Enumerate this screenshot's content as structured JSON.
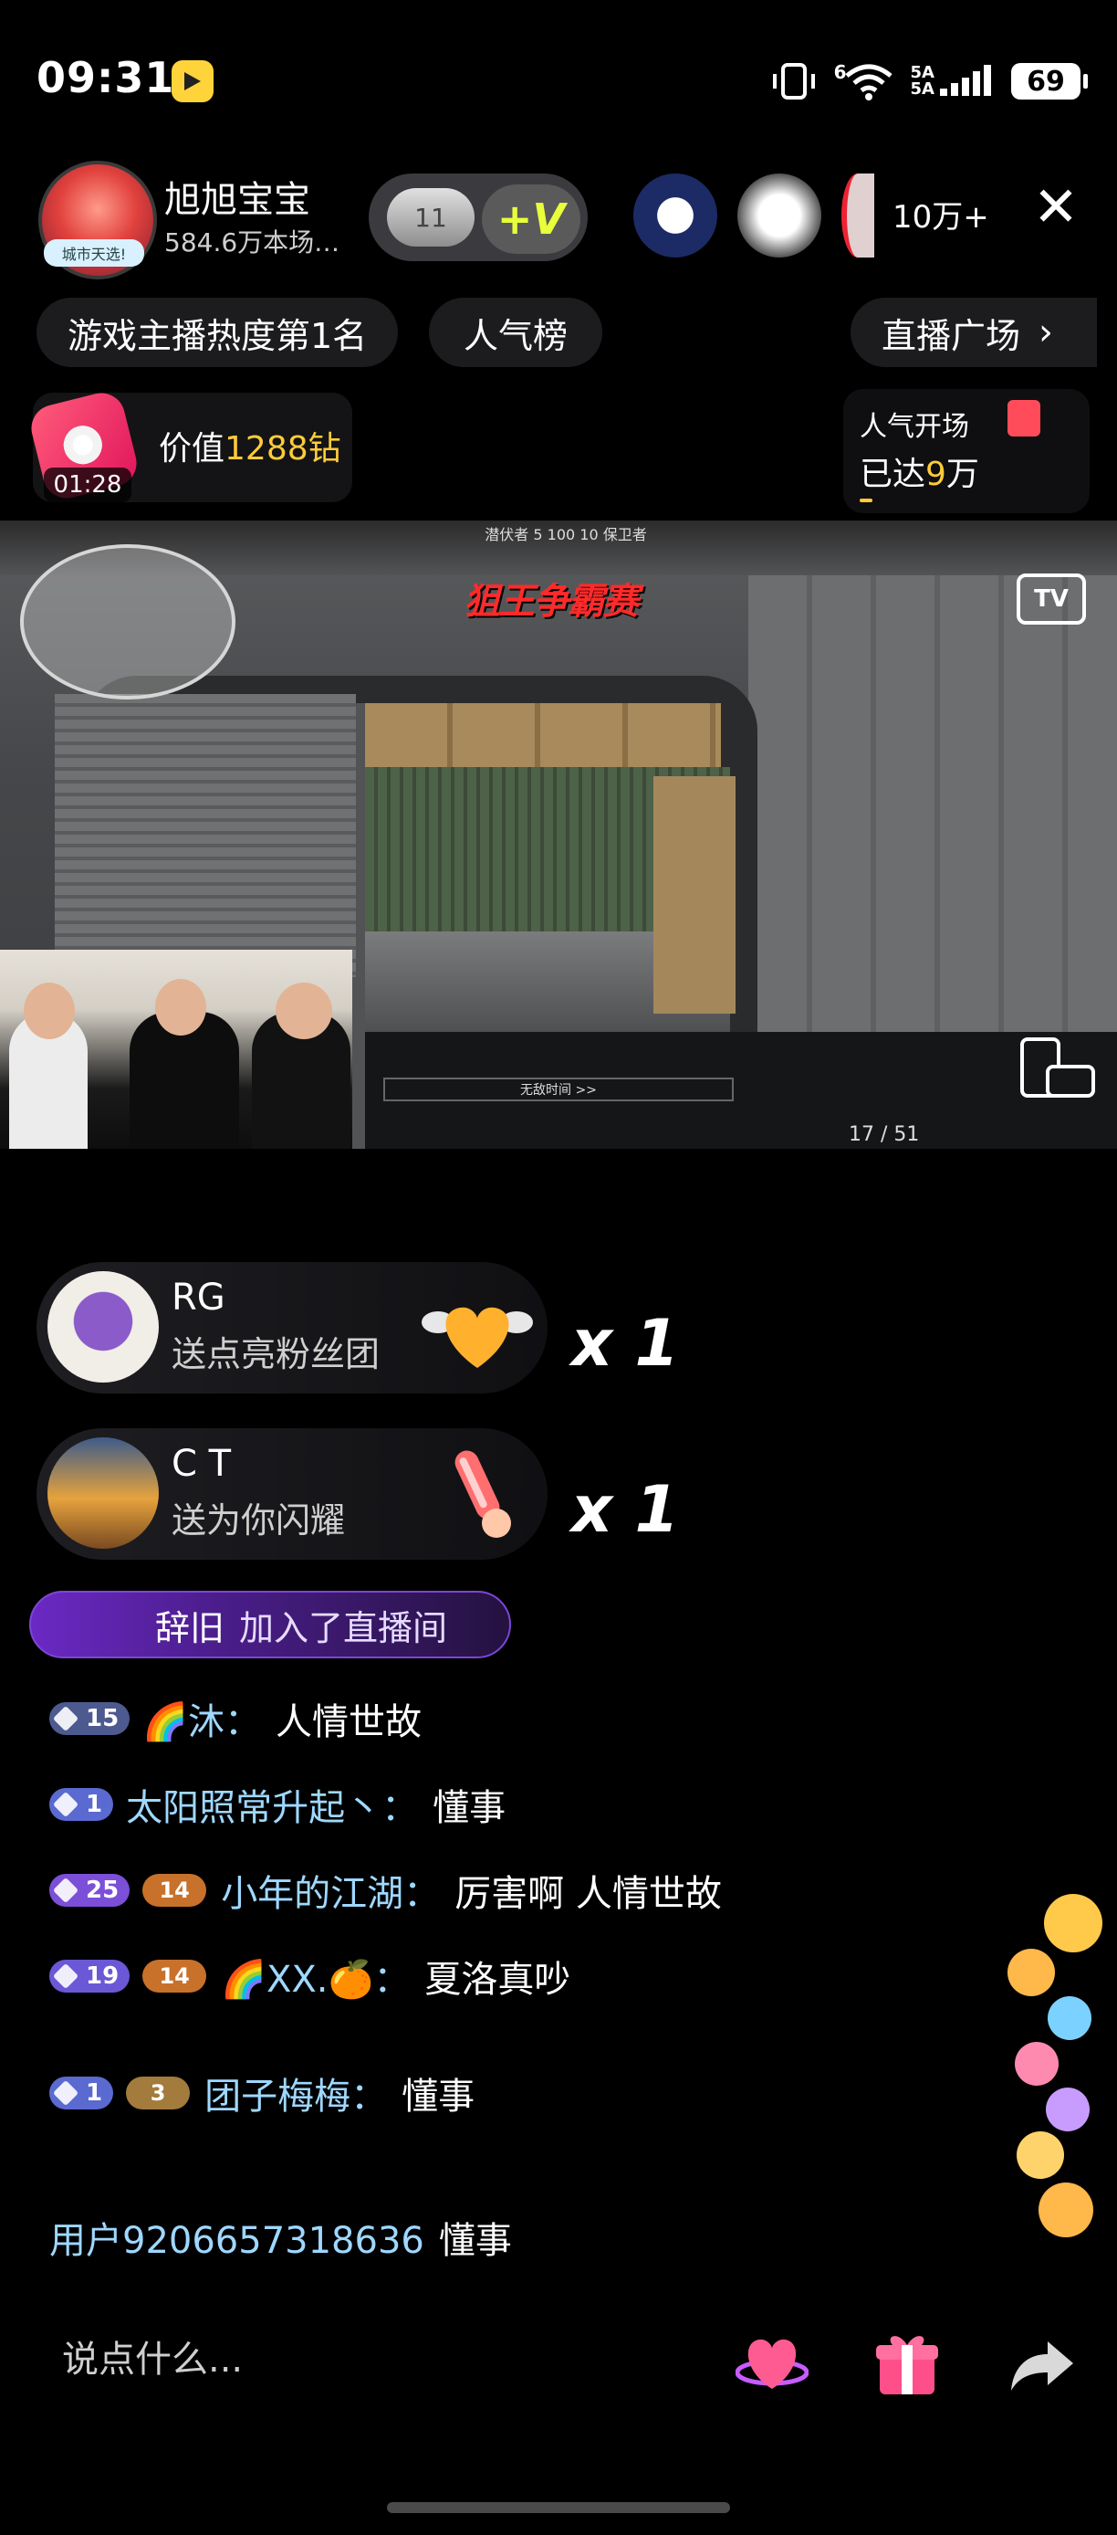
{
  "status": {
    "time": "09:31",
    "net_label": "6",
    "signal_label": "5A\n5A",
    "battery": "69"
  },
  "streamer": {
    "name": "旭旭宝宝",
    "sub": "584.6万本场…",
    "avatar_tag": "城市天选!",
    "badge_level": "11",
    "badge_v": "+V",
    "viewers": "10万+"
  },
  "chips": {
    "hot": "游戏主播热度第1名",
    "rank": "人气榜",
    "plaza": "直播广场"
  },
  "gift_timer": {
    "time": "01:28",
    "value_prefix": "价值",
    "value_amount": "1288钻"
  },
  "popularity": {
    "title": "人气开场",
    "prefix": "已达",
    "amount": "9",
    "unit": "万"
  },
  "video": {
    "score_line": "潜伏者  5  100  10  保卫者",
    "title_text": "狙王争霸赛",
    "hud": "无敌时间 >>",
    "ammo": "17 / 51",
    "tv_label": "TV"
  },
  "gift_messages": [
    {
      "name": "RG",
      "text": "送点亮粉丝团",
      "count": "x 1"
    },
    {
      "name": "C T",
      "text": "送为你闪耀",
      "count": "x 1"
    }
  ],
  "join": {
    "user": "辞旧",
    "text": "加入了直播间"
  },
  "chat": [
    {
      "level": "15",
      "fan": "",
      "user": "🌈沐：",
      "msg": "人情世故",
      "level_color": "#4d5a8f"
    },
    {
      "level": "1",
      "fan": "",
      "user": "太阳照常升起丶：",
      "msg": "懂事",
      "level_color": "#5a6ad0"
    },
    {
      "level": "25",
      "fan": "14",
      "user": "小年的江湖：",
      "msg": "厉害啊 人情世故",
      "level_color": "#7b4fd8"
    },
    {
      "level": "19",
      "fan": "14",
      "user": "🌈XX.🍊：",
      "msg": "夏洛真吵",
      "level_color": "#6a58d6"
    },
    {
      "level": "1",
      "fan": "3",
      "user": "团子梅梅：",
      "msg": "懂事",
      "level_color": "#5a6ad0"
    },
    {
      "level": "",
      "fan": "",
      "user": "用户9206657318636",
      "msg": "懂事",
      "level_color": ""
    }
  ],
  "input": {
    "placeholder": "说点什么..."
  },
  "colors": {
    "accent_gold": "#ffcc38",
    "chat_user": "#9fd8ff",
    "join_purple": "#6b29c4"
  }
}
